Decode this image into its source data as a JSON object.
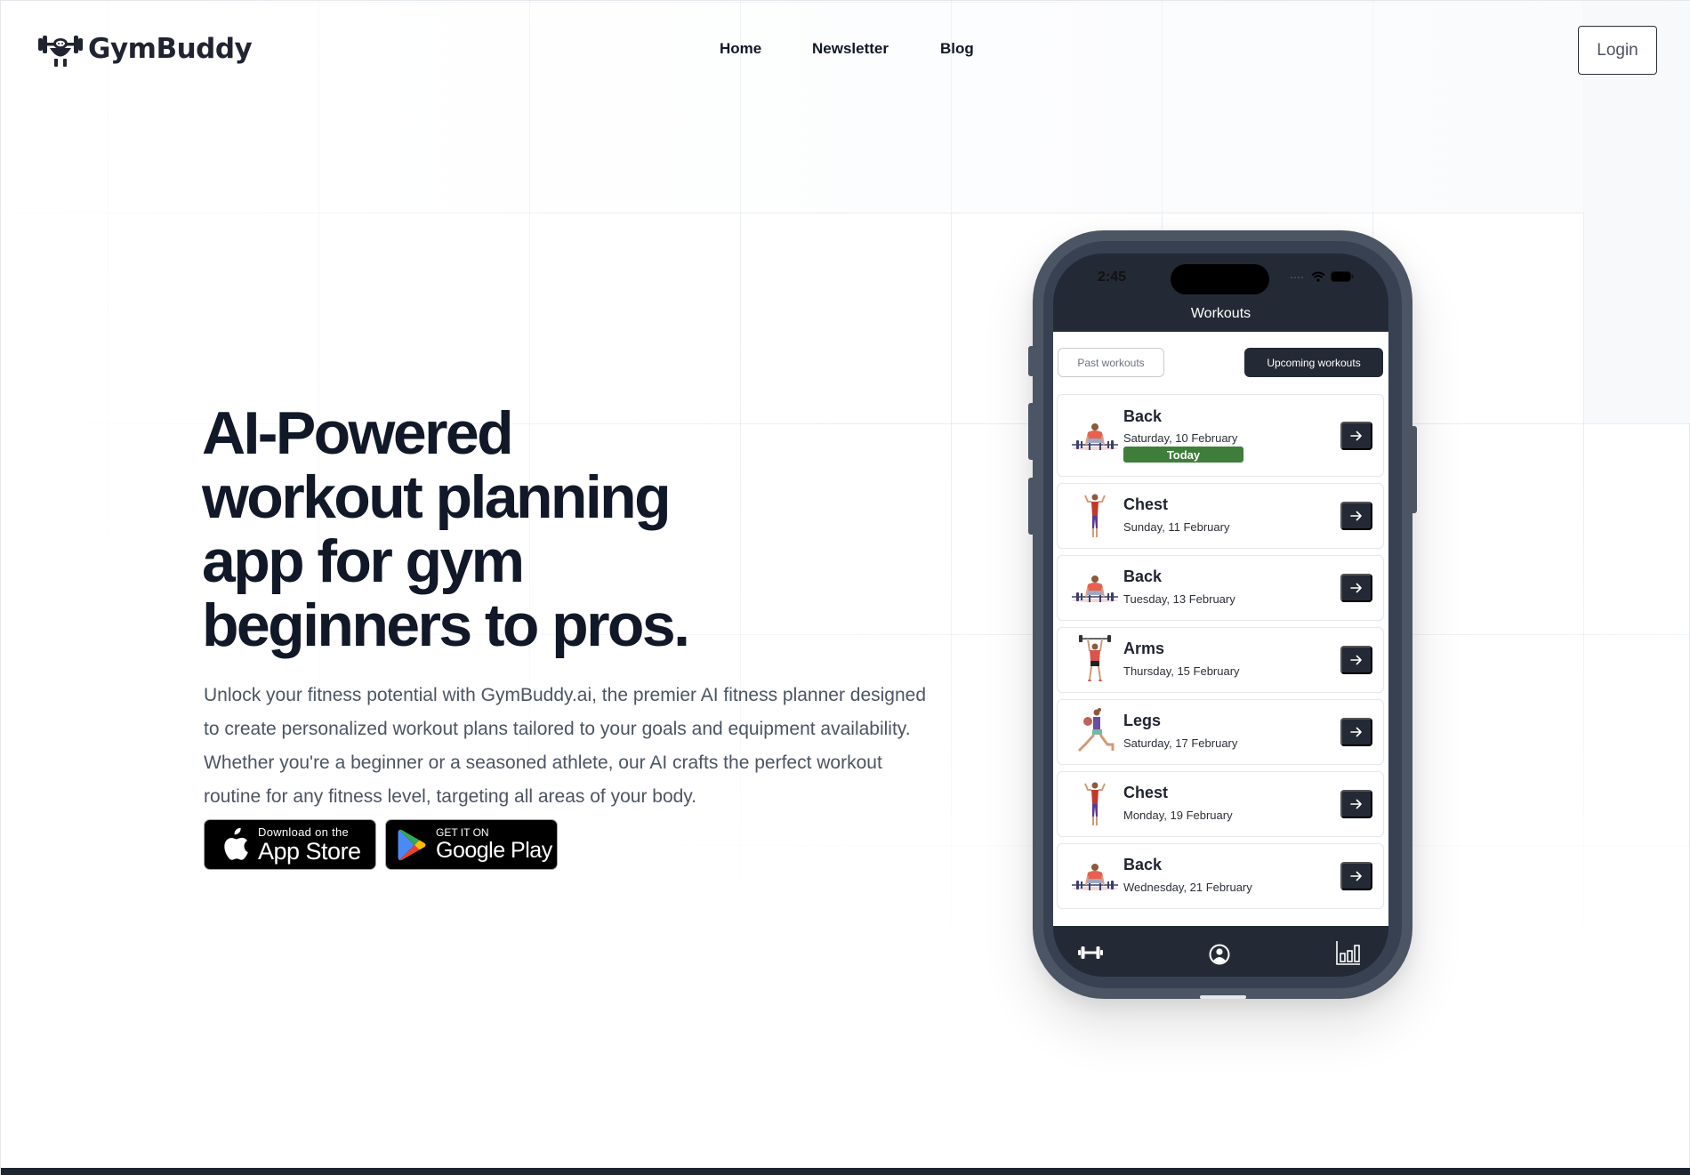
{
  "brand": {
    "name": "GymBuddy",
    "logo_icon": "weightlifter-mascot-icon"
  },
  "nav": {
    "items": [
      {
        "label": "Home"
      },
      {
        "label": "Newsletter"
      },
      {
        "label": "Blog"
      }
    ],
    "login_label": "Login"
  },
  "hero": {
    "title_lines": [
      "AI-Powered",
      "workout planning",
      "app for gym",
      "beginners to pros."
    ],
    "description": "Unlock your fitness potential with GymBuddy.ai, the premier AI fitness planner designed to create personalized workout plans tailored to your goals and equipment availability. Whether you're a beginner or a seasoned athlete, our AI crafts the perfect workout routine for any fitness level, targeting all areas of your body.",
    "app_store": {
      "small": "Download on the",
      "big": "App Store",
      "icon": "apple-icon"
    },
    "google_play": {
      "small": "GET IT ON",
      "big": "Google Play",
      "icon": "google-play-icon"
    }
  },
  "phone": {
    "status_time": "2:45",
    "screen_title": "Workouts",
    "tabs": {
      "past": "Past workouts",
      "upcoming": "Upcoming workouts",
      "active": "upcoming"
    },
    "today_badge": "Today",
    "workouts": [
      {
        "name": "Back",
        "date": "Saturday, 10 February",
        "today": true,
        "art": "deadlift"
      },
      {
        "name": "Chest",
        "date": "Sunday, 11 February",
        "today": false,
        "art": "flex"
      },
      {
        "name": "Back",
        "date": "Tuesday, 13 February",
        "today": false,
        "art": "deadlift"
      },
      {
        "name": "Arms",
        "date": "Thursday, 15 February",
        "today": false,
        "art": "overhead"
      },
      {
        "name": "Legs",
        "date": "Saturday, 17 February",
        "today": false,
        "art": "lunge"
      },
      {
        "name": "Chest",
        "date": "Monday, 19 February",
        "today": false,
        "art": "flex"
      },
      {
        "name": "Back",
        "date": "Wednesday, 21 February",
        "today": false,
        "art": "deadlift"
      }
    ],
    "tabbar": [
      {
        "icon": "dumbbell-icon"
      },
      {
        "icon": "profile-icon"
      },
      {
        "icon": "bar-chart-icon"
      }
    ]
  },
  "colors": {
    "primary_dark": "#232a35",
    "today_green": "#3f7d3a",
    "text_dark": "#111827",
    "text_muted": "#4b5563"
  }
}
